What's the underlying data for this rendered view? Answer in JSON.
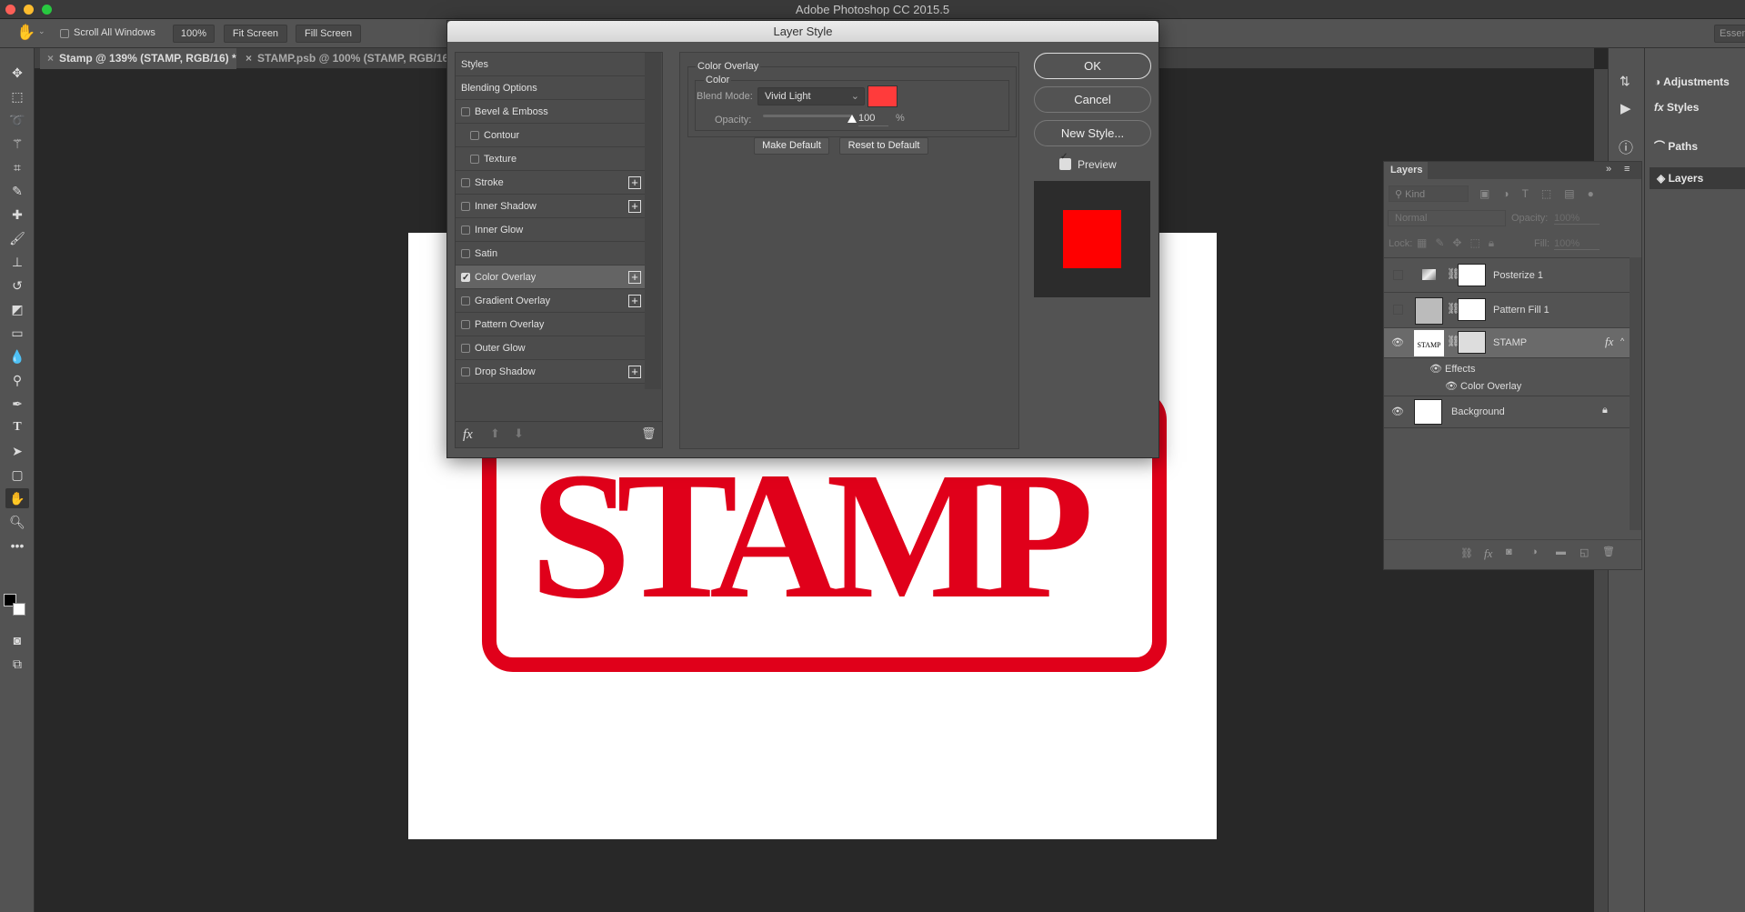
{
  "app": {
    "title": "Adobe Photoshop CC 2015.5"
  },
  "options": {
    "scroll_all_windows": "Scroll All Windows",
    "zoom_100": "100%",
    "fit_screen": "Fit Screen",
    "fill_screen": "Fill Screen",
    "workspace": "Essen"
  },
  "tabs": [
    {
      "label": "Stamp @ 139% (STAMP, RGB/16) *",
      "active": true
    },
    {
      "label": "STAMP.psb @ 100% (STAMP, RGB/16)",
      "active": false
    }
  ],
  "canvas": {
    "stamp_text": "STAMP",
    "stamp_color": "#e0001a"
  },
  "dialog": {
    "title": "Layer Style",
    "styles_list": [
      {
        "label": "Styles",
        "checkbox": false,
        "indent": false,
        "plus": false
      },
      {
        "label": "Blending Options",
        "checkbox": false,
        "indent": false,
        "plus": false
      },
      {
        "label": "Bevel & Emboss",
        "checkbox": true,
        "checked": false,
        "indent": false,
        "plus": false
      },
      {
        "label": "Contour",
        "checkbox": true,
        "checked": false,
        "indent": true,
        "plus": false
      },
      {
        "label": "Texture",
        "checkbox": true,
        "checked": false,
        "indent": true,
        "plus": false
      },
      {
        "label": "Stroke",
        "checkbox": true,
        "checked": false,
        "indent": false,
        "plus": true
      },
      {
        "label": "Inner Shadow",
        "checkbox": true,
        "checked": false,
        "indent": false,
        "plus": true
      },
      {
        "label": "Inner Glow",
        "checkbox": true,
        "checked": false,
        "indent": false,
        "plus": false
      },
      {
        "label": "Satin",
        "checkbox": true,
        "checked": false,
        "indent": false,
        "plus": false
      },
      {
        "label": "Color Overlay",
        "checkbox": true,
        "checked": true,
        "indent": false,
        "plus": true,
        "selected": true
      },
      {
        "label": "Gradient Overlay",
        "checkbox": true,
        "checked": false,
        "indent": false,
        "plus": true
      },
      {
        "label": "Pattern Overlay",
        "checkbox": true,
        "checked": false,
        "indent": false,
        "plus": false
      },
      {
        "label": "Outer Glow",
        "checkbox": true,
        "checked": false,
        "indent": false,
        "plus": false
      },
      {
        "label": "Drop Shadow",
        "checkbox": true,
        "checked": false,
        "indent": false,
        "plus": true
      }
    ],
    "section_title": "Color Overlay",
    "group_title": "Color",
    "blend_mode_label": "Blend Mode:",
    "blend_mode": "Vivid Light",
    "overlay_color": "#ff3b3b",
    "opacity_label": "Opacity:",
    "opacity_value": "100",
    "opacity_unit": "%",
    "make_default": "Make Default",
    "reset_default": "Reset to Default",
    "ok": "OK",
    "cancel": "Cancel",
    "new_style": "New Style...",
    "preview_label": "Preview",
    "preview_checked": true,
    "preview_color": "#ff0000",
    "fx_label": "fx"
  },
  "layers_panel": {
    "title": "Layers",
    "kind": "Kind",
    "blend": "Normal",
    "opacity_label": "Opacity:",
    "opacity": "100%",
    "lock_label": "Lock:",
    "fill_label": "Fill:",
    "fill": "100%",
    "layers": [
      {
        "name": "Posterize 1",
        "visible": false
      },
      {
        "name": "Pattern Fill 1",
        "visible": false
      },
      {
        "name": "STAMP",
        "visible": true,
        "selected": true,
        "fx": "fx"
      },
      {
        "name": "Background",
        "visible": true,
        "locked": true
      }
    ],
    "effects_label": "Effects",
    "effect_item": "Color Overlay"
  },
  "dock": {
    "items": [
      "Adjustments",
      "Styles",
      "Paths",
      "Layers"
    ]
  }
}
